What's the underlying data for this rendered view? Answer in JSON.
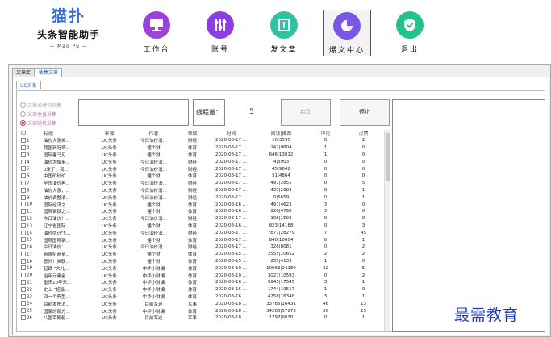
{
  "logo": {
    "mark": "猫扑",
    "name": "头条智能助手",
    "en": "— Mao Pu —"
  },
  "nav": [
    {
      "key": "workbench",
      "label": "工作台",
      "color": "#9b43d6",
      "icon": "monitor-icon"
    },
    {
      "key": "account",
      "label": "账号",
      "color": "#8b3fe0",
      "icon": "sliders-icon"
    },
    {
      "key": "publish",
      "label": "发文章",
      "color": "#2fc1a0",
      "icon": "document-icon"
    },
    {
      "key": "hot",
      "label": "爆文中心",
      "color": "#7b55e6",
      "icon": "pie-icon"
    },
    {
      "key": "exit",
      "label": "退出",
      "color": "#22c28c",
      "icon": "shield-icon"
    }
  ],
  "tabs": [
    "文章库",
    "收集文章"
  ],
  "subtab": "UC头条",
  "radios": [
    "文章关键词采集",
    "文章垂直采集",
    "文章随机采集"
  ],
  "threads_label": "线程量：",
  "threads_value": "5",
  "buttons": {
    "start": "启动",
    "stop": "停止"
  },
  "table": {
    "headers": [
      "ID",
      "标题",
      "来源",
      "作者",
      "领域",
      "时间",
      "阅读|推荐",
      "评论",
      "点赞"
    ],
    "rows": [
      [
        "1",
        "油价大涨美...",
        "UC头条",
        "今日油价消...",
        "财经",
        "2020-08-17 ...",
        "10|3530",
        "0",
        "2"
      ],
      [
        "2",
        "我国新冠病...",
        "UC头条",
        "懂个财",
        "体育",
        "2020-08-17 ...",
        "242|9604",
        "1",
        "0"
      ],
      [
        "3",
        "国际客马见...",
        "UC头条",
        "懂个财",
        "体育",
        "2020-08-17 ...",
        "646|13812",
        "1",
        "0"
      ],
      [
        "4",
        "油价大幅来...",
        "UC头条",
        "今日油价消...",
        "财经",
        "2020-08-17 ...",
        "4|3903",
        "0",
        "0"
      ],
      [
        "5",
        "0米了，我...",
        "UC头条",
        "今日油价消...",
        "财经",
        "2020-08-17 ...",
        "45|9842",
        "0",
        "0"
      ],
      [
        "6",
        "中国矿砂价...",
        "UC头条",
        "懂个财",
        "体育",
        "2020-08-17 ...",
        "51|4864",
        "0",
        "0"
      ],
      [
        "7",
        "全国油价再...",
        "UC头条",
        "今日油价消...",
        "财经",
        "2020-08-17 ...",
        "497|2851",
        "0",
        "5"
      ],
      [
        "8",
        "油价大涨，...",
        "UC头条",
        "今日油价消...",
        "财经",
        "2020-08-17 ...",
        "435|2683",
        "0",
        "1"
      ],
      [
        "9",
        "油价调整消...",
        "UC头条",
        "今日油价消...",
        "财经",
        "2020-08-17 ...",
        "0|5659",
        "0",
        "1"
      ],
      [
        "10",
        "国际经济之...",
        "UC头条",
        "懂个财",
        "体育",
        "2020-08-16 ...",
        "497|4623",
        "3",
        "0"
      ],
      [
        "11",
        "国际钢铁之...",
        "UC头条",
        "懂个财",
        "体育",
        "2020-08-16 ...",
        "226|4798",
        "3",
        "0"
      ],
      [
        "12",
        "今日油价！...",
        "UC头条",
        "今日油价消...",
        "财经",
        "2020-08-17 ...",
        "108|1593",
        "0",
        "0"
      ],
      [
        "13",
        "辽宁省国际...",
        "UC头条",
        "懂个财",
        "体育",
        "2020-08-16 ...",
        "823|14188",
        "0",
        "3"
      ],
      [
        "14",
        "油价估计\"5...",
        "UC头条",
        "今日油价消...",
        "财经",
        "2020-08-17 ...",
        "7877|28279",
        "7",
        "45"
      ],
      [
        "15",
        "国际国际钢...",
        "UC头条",
        "懂个财",
        "体育",
        "2020-08-17 ...",
        "840|10604",
        "0",
        "1"
      ],
      [
        "16",
        "今日油价：...",
        "UC头条",
        "今日油价消...",
        "财经",
        "2020-08-17 ...",
        "326|8081",
        "0",
        "2"
      ],
      [
        "17",
        "新疆招商金...",
        "UC头条",
        "懂个财",
        "体育",
        "2020-08-15 ...",
        "2555|10652",
        "2",
        "2"
      ],
      [
        "18",
        "意外！美联...",
        "UC头条",
        "懂个财",
        "体育",
        "2020-08-15 ...",
        "255|4133",
        "1",
        "0"
      ],
      [
        "19",
        "起跌 \"大儿...",
        "UC头条",
        "中华小财编",
        "体育",
        "2020-08-10 ...",
        "10063|24180",
        "32",
        "5"
      ],
      [
        "20",
        "当年元素金...",
        "UC头条",
        "中华小财编",
        "体育",
        "2020-08-10 ...",
        "3027|10593",
        "0",
        "2"
      ],
      [
        "21",
        "重庆10年来...",
        "UC头条",
        "中华小财编",
        "体育",
        "2020-08-16 ...",
        "5843|17545",
        "3",
        "1"
      ],
      [
        "22",
        "史上 \"超级...",
        "UC头条",
        "中华小财编",
        "体育",
        "2020-08-16 ...",
        "1744|19517",
        "1",
        "0"
      ],
      [
        "23",
        "四一个典型...",
        "UC头条",
        "中华小财编",
        "体育",
        "2020-08-16 ...",
        "4258|16348",
        "3",
        "1"
      ],
      [
        "24",
        "目前发布消...",
        "UC头条",
        "目前军迷",
        "军事",
        "2020-08-18 ...",
        "33785|16431",
        "46",
        "13"
      ],
      [
        "25",
        "国家的部分...",
        "UC头条",
        "中华小财编",
        "体育",
        "2020-08-18 ...",
        "34208|57275",
        "36",
        "25"
      ],
      [
        "26",
        "八国军舰驱...",
        "UC头条",
        "目前军迷",
        "军事",
        "2020-08-18 ...",
        "1297|9830",
        "0",
        "1"
      ]
    ]
  },
  "watermark": "最需教育"
}
